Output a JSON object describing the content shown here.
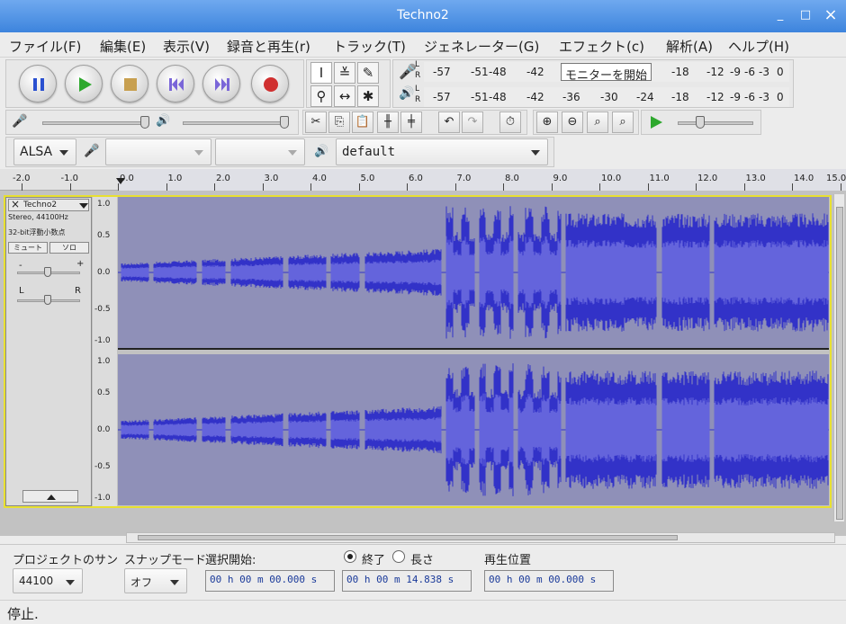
{
  "window": {
    "title": "Techno2",
    "minimize": "_",
    "maximize": "□",
    "close": "×"
  },
  "menu": [
    "ファイル(F)",
    "編集(E)",
    "表示(V)",
    "録音と再生(r)",
    "トラック(T)",
    "ジェネレーター(G)",
    "エフェクト(c)",
    "解析(A)",
    "ヘルプ(H)"
  ],
  "meters": {
    "record_scale": [
      "-57",
      "-51",
      "-48",
      "-42",
      "-18",
      "-12",
      "-9",
      "-6",
      "-3",
      "0"
    ],
    "monitor_button": "モニターを開始",
    "play_scale": [
      "-57",
      "-51",
      "-48",
      "-42",
      "-36",
      "-30",
      "-24",
      "-18",
      "-12",
      "-9",
      "-6",
      "-3",
      "0"
    ],
    "channel_L": "L",
    "channel_R": "R"
  },
  "device": {
    "host": "ALSA",
    "recording_device": "",
    "channels": "",
    "playback_device": "default"
  },
  "ruler": [
    "-2.0",
    "-1.0",
    "0.0",
    "1.0",
    "2.0",
    "3.0",
    "4.0",
    "5.0",
    "6.0",
    "7.0",
    "8.0",
    "9.0",
    "10.0",
    "11.0",
    "12.0",
    "13.0",
    "14.0",
    "15.0"
  ],
  "track": {
    "name": "Techno2",
    "info1": "Stereo, 44100Hz",
    "info2": "32-bit浮動小数点",
    "mute": "ミュート",
    "solo": "ソロ",
    "gain_minus": "-",
    "gain_plus": "+",
    "pan_L": "L",
    "pan_R": "R",
    "scale": [
      "1.0",
      "0.5",
      "0.0",
      "-0.5",
      "-1.0"
    ]
  },
  "bottom": {
    "rate_label": "プロジェクトのサン",
    "rate_value": "44100",
    "snap_label": "スナップモード",
    "snap_value": "オフ",
    "sel_start_label": "選択開始:",
    "end_label": "終了",
    "length_label": "長さ",
    "sel_start_value": "00 h 00 m 00.000 s",
    "sel_end_value": "00 h 00 m 14.838 s",
    "pos_label": "再生位置",
    "pos_value": "00 h 00 m 00.000 s"
  },
  "status": "停止.",
  "colors": {
    "wave_dark": "#3232c8",
    "wave_light": "#6464dc",
    "wave_bg": "#8f90b8",
    "selection_border": "#e8e030"
  }
}
